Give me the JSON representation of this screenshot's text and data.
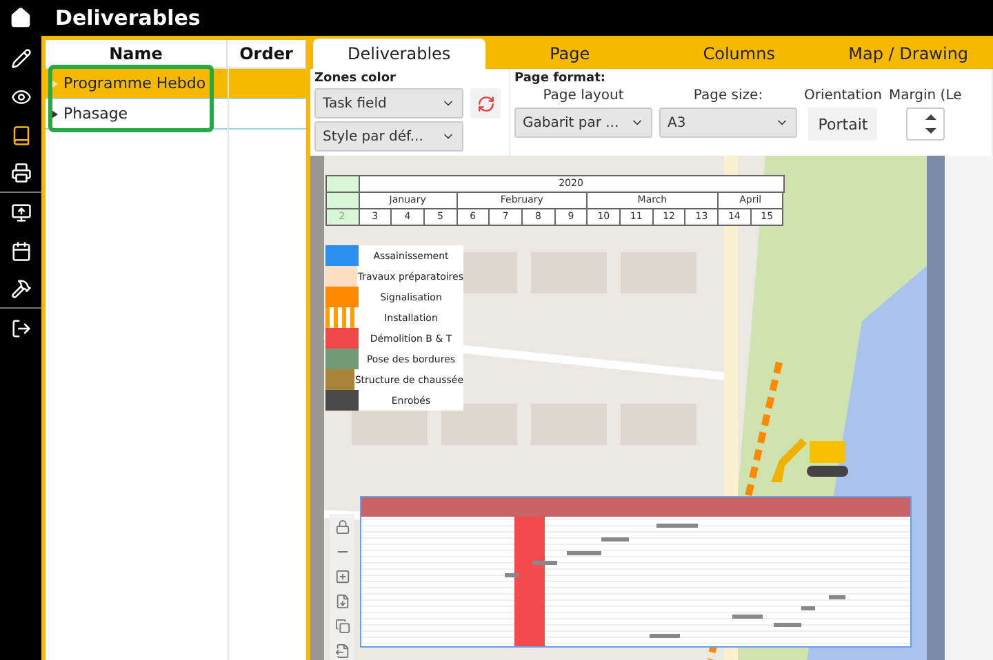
{
  "app_title": "Deliverables",
  "nav": [
    {
      "kind": "pencil",
      "selected": false
    },
    {
      "kind": "eye",
      "selected": false
    },
    {
      "kind": "book",
      "selected": true
    },
    {
      "kind": "printer",
      "selected": false
    },
    {
      "kind": "screen",
      "selected": false
    },
    {
      "kind": "calendar",
      "selected": false
    },
    {
      "kind": "tools",
      "selected": false
    },
    {
      "kind": "exit",
      "selected": false
    }
  ],
  "table": {
    "columns": [
      "Name",
      "Order"
    ],
    "rows": [
      {
        "name": "Programme Hebdo",
        "selected": true
      },
      {
        "name": "Phasage",
        "selected": false
      }
    ]
  },
  "tabs": [
    {
      "label": "Deliverables",
      "selected": true
    },
    {
      "label": "Page",
      "selected": false
    },
    {
      "label": "Columns",
      "selected": false
    },
    {
      "label": "Map / Drawing",
      "selected": false
    }
  ],
  "zones_color": {
    "label": "Zones color",
    "field": "Task field",
    "style": "Style par déf..."
  },
  "page_format": {
    "label": "Page format:",
    "layout_label": "Page layout",
    "layout": "Gabarit par ...",
    "size_label": "Page size:",
    "size": "A3",
    "orientation_label": "Orientation",
    "orientation": "Portait",
    "margin_label": "Margin (Le"
  },
  "timeline": {
    "year": "2020",
    "start_week": "2",
    "months": [
      {
        "label": "January",
        "weeks": [
          "3",
          "4",
          "5"
        ]
      },
      {
        "label": "February",
        "weeks": [
          "6",
          "7",
          "8",
          "9"
        ]
      },
      {
        "label": "March",
        "weeks": [
          "10",
          "11",
          "12",
          "13"
        ]
      },
      {
        "label": "April",
        "weeks": [
          "14",
          "15"
        ]
      }
    ]
  },
  "legend": [
    {
      "label": "Assainissement",
      "color": "#2b8ff0",
      "kind": "solid"
    },
    {
      "label": "Travaux préparatoires",
      "color": "#fde0c4",
      "kind": "solid"
    },
    {
      "label": "Signalisation",
      "color": "#ff8a00",
      "kind": "solid"
    },
    {
      "label": "Installation",
      "color": "#ffa000",
      "kind": "striped"
    },
    {
      "label": "Démolition B & T",
      "color": "#f04848",
      "kind": "solid"
    },
    {
      "label": "Pose des bordures",
      "color": "#6f9a72",
      "kind": "solid"
    },
    {
      "label": "Structure de chaussée",
      "color": "#a8823a",
      "kind": "solid"
    },
    {
      "label": "Enrobés",
      "color": "#4a4a4a",
      "kind": "solid"
    }
  ]
}
